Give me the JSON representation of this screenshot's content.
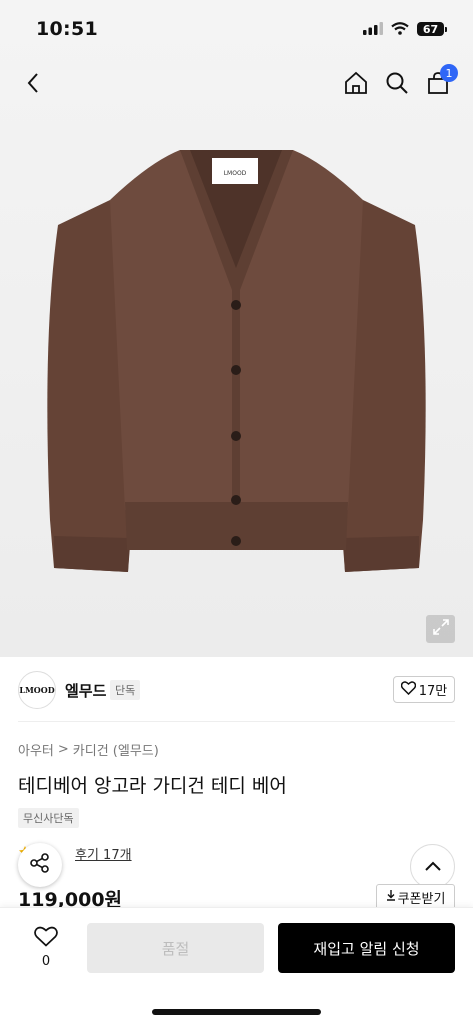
{
  "status": {
    "time": "10:51",
    "battery": "67",
    "icons": [
      "signal-icon",
      "wifi-icon",
      "battery-icon"
    ]
  },
  "nav": {
    "icons": [
      "back-icon",
      "home-icon",
      "search-icon",
      "cart-icon"
    ],
    "cart_count": "1"
  },
  "hero": {
    "garment_label": "LMOOD",
    "garment_color": "#6e4b3e",
    "expand_icon": "expand-icon"
  },
  "brand": {
    "logo_text": "LMOOD",
    "name": "엘무드",
    "badge": "단독",
    "likes": "17만"
  },
  "breadcrumb": {
    "category": "아우터",
    "separator": ">",
    "subcategory": "카디건 (엘무드)"
  },
  "product": {
    "title": "테디베어 앙고라 가디건 테디 베어",
    "store_badge": "무신사단독",
    "review_link": "후기 17개",
    "price": "119,000원",
    "coupon_label": "쿠폰받기"
  },
  "bottom_bar": {
    "wish_count": "0",
    "soldout_label": "품절",
    "restock_label": "재입고 알림 신청"
  },
  "colors": {
    "accent": "#2f66f6",
    "primary_button": "#000000",
    "disabled_button": "#e9e9e9",
    "star": "#f5b400"
  }
}
